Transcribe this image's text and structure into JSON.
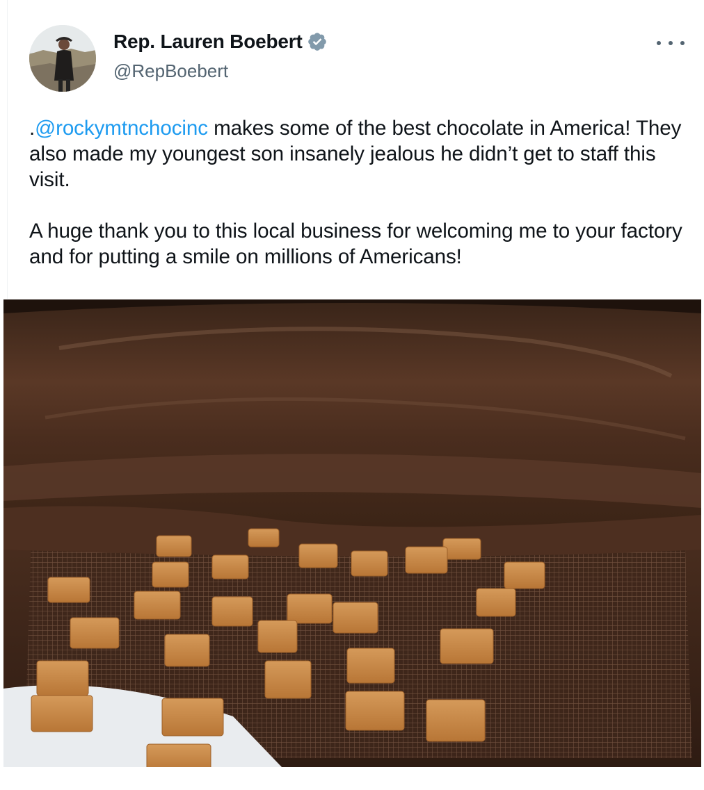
{
  "author": {
    "display_name": "Rep. Lauren Boebert",
    "handle": "@RepBoebert",
    "verified_icon": "verified-badge-icon",
    "avatar_icon": "profile-avatar"
  },
  "more_icon": "more-options-icon",
  "tweet": {
    "prefix": ".",
    "mention": "@rockymtnchocinc",
    "body": " makes some of the best chocolate in America! They also made my youngest son insanely jealous he didn’t get to staff this visit.\n\nA huge thank you to this local business for welcoming me to your factory and for putting a smile on millions of Americans!"
  },
  "media": {
    "icon": "photo-chocolate-factory",
    "caption_visible": false
  },
  "colors": {
    "link": "#1d9bf0",
    "text": "#0f1419",
    "secondary": "#536471",
    "verified": "#829aab"
  }
}
